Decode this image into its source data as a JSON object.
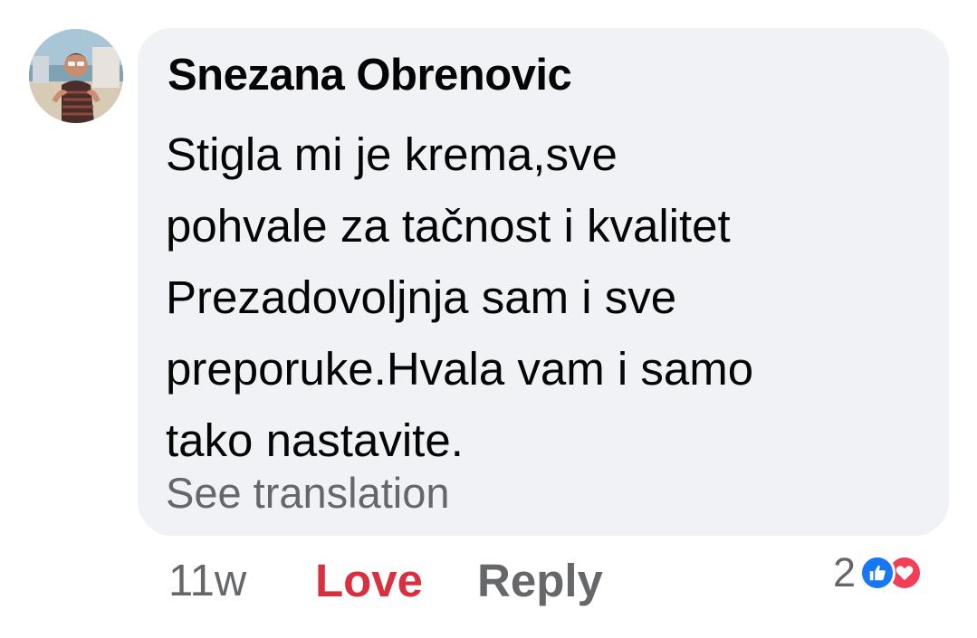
{
  "comment": {
    "author": "Snezana Obrenovic",
    "text_lines": [
      "Stigla mi je krema,sve",
      "pohvale za tačnost i kvalitet",
      "Prezadovoljnja sam i sve",
      "preporuke.Hvala vam i samo",
      "tako nastavite."
    ],
    "see_translation": "See translation"
  },
  "actions": {
    "time": "11w",
    "love_label": "Love",
    "reply_label": "Reply",
    "reaction_count": "2",
    "reaction_icons": [
      "like-icon",
      "heart-icon"
    ]
  },
  "colors": {
    "bubble_bg": "#f0f2f5",
    "love": "#d93040",
    "muted": "#65676b",
    "like": "#1877f2",
    "heart": "#f33e58"
  }
}
